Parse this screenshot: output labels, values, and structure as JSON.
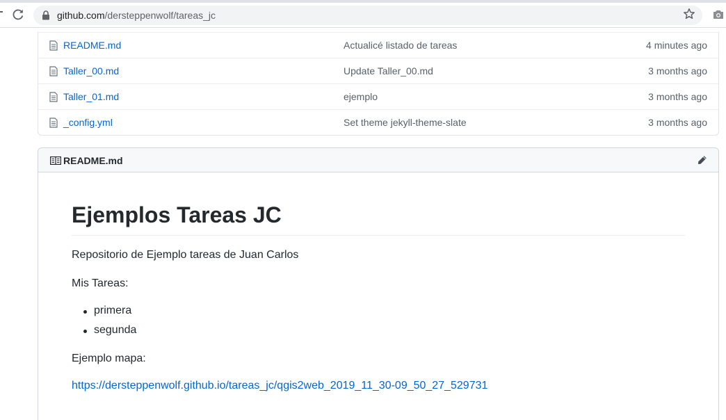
{
  "browser": {
    "url_host": "github.com",
    "url_path": "/dersteppenwolf/tareas_jc"
  },
  "files": [
    {
      "name": "README.md",
      "message": "Actualicé listado de tareas",
      "age": "4 minutes ago"
    },
    {
      "name": "Taller_00.md",
      "message": "Update Taller_00.md",
      "age": "3 months ago"
    },
    {
      "name": "Taller_01.md",
      "message": "ejemplo",
      "age": "3 months ago"
    },
    {
      "name": "_config.yml",
      "message": "Set theme jekyll-theme-slate",
      "age": "3 months ago"
    }
  ],
  "readme": {
    "filename": "README.md",
    "heading": "Ejemplos Tareas JC",
    "intro": "Repositorio de Ejemplo tareas de Juan Carlos",
    "tasks_label": "Mis Tareas:",
    "tasks": [
      "primera",
      "segunda"
    ],
    "map_label": "Ejemplo mapa:",
    "map_link": "https://dersteppenwolf.github.io/tareas_jc/qgis2web_2019_11_30-09_50_27_529731"
  },
  "icons": {
    "reload": "reload-icon",
    "lock": "lock-icon",
    "star": "star-icon",
    "camera": "camera-icon",
    "file": "file-icon",
    "book": "book-icon",
    "pencil": "pencil-icon"
  },
  "colors": {
    "link": "#0366d6",
    "text": "#24292e",
    "muted": "#586069",
    "header_bg": "#f6f8fa"
  }
}
